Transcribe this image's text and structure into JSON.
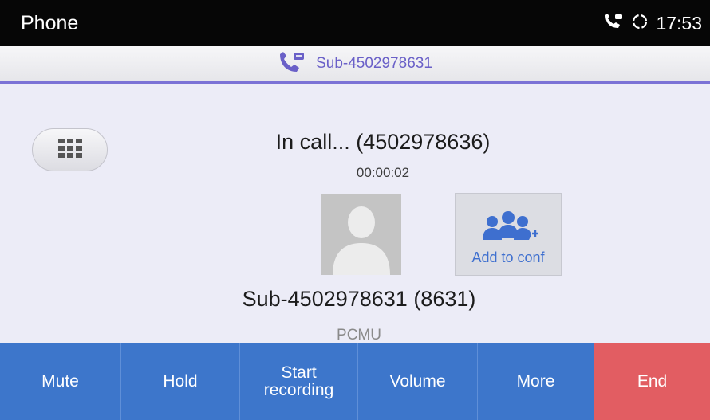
{
  "status_bar": {
    "app_title": "Phone",
    "time": "17:53",
    "icons": [
      "call-active-icon",
      "sync-icon"
    ]
  },
  "account": {
    "icon": "transfer-call-icon",
    "label": "Sub-4502978631"
  },
  "call": {
    "status": "In call... (4502978636)",
    "timer": "00:00:02",
    "peer": "Sub-4502978631 (8631)",
    "codec": "PCMU"
  },
  "add_conf": {
    "label": "Add to conf",
    "icon": "add-group-icon"
  },
  "dialpad": {
    "icon": "dialpad-icon"
  },
  "actions": [
    {
      "label": "Mute"
    },
    {
      "label": "Hold"
    },
    {
      "label": "Start\nrecording"
    },
    {
      "label": "Volume"
    },
    {
      "label": "More"
    },
    {
      "label": "End"
    }
  ],
  "colors": {
    "accent": "#7b72d6",
    "action_blue": "#3d76cb",
    "end_red": "#e25d62",
    "link_blue": "#3e6fcf"
  }
}
